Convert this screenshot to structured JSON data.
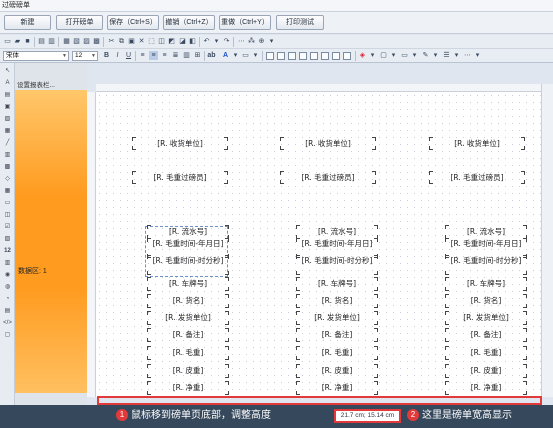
{
  "window": {
    "title": "过磅磅单"
  },
  "actions": [
    {
      "label": "新建"
    },
    {
      "label": "打开磅单"
    },
    {
      "label": "保存（Ctrl+S）"
    },
    {
      "label": "撤销（Ctrl+Z）"
    },
    {
      "label": "重做（Ctrl+Y）"
    },
    {
      "label": "打印测试"
    }
  ],
  "format": {
    "font_name": "宋体",
    "font_size": "12"
  },
  "band_panel": {
    "title": "设置报表栏...",
    "band_label": "数据区: 1"
  },
  "top_fields": [
    [
      "[R. 收货单位]",
      "[R. 收货单位]",
      "[R. 收货单位]"
    ],
    [
      "[R. 毛重过磅员]",
      "[R. 毛重过磅员]",
      "[R. 毛重过磅员]"
    ]
  ],
  "data_fields": [
    "[R. 流水号]",
    "[R. 毛重时间-年月日]",
    "[R. 毛重时间-时分秒]",
    "[R. 车牌号]",
    "[R. 货名]",
    "[R. 发货单位]",
    "[R. 备注]",
    "[R. 毛重]",
    "[R. 皮重]",
    "[R. 净重]"
  ],
  "status": {
    "size_readout": "21.7 cm; 15.14 cm",
    "callout_1": {
      "num": "1",
      "text": "鼠标移到磅单页底部，调整高度"
    },
    "callout_2": {
      "num": "2",
      "text": "这里是磅单宽高显示"
    }
  },
  "colors": {
    "band": "#ff9b1f",
    "callout": "#e23a3a",
    "statusbar": "#35485c"
  }
}
